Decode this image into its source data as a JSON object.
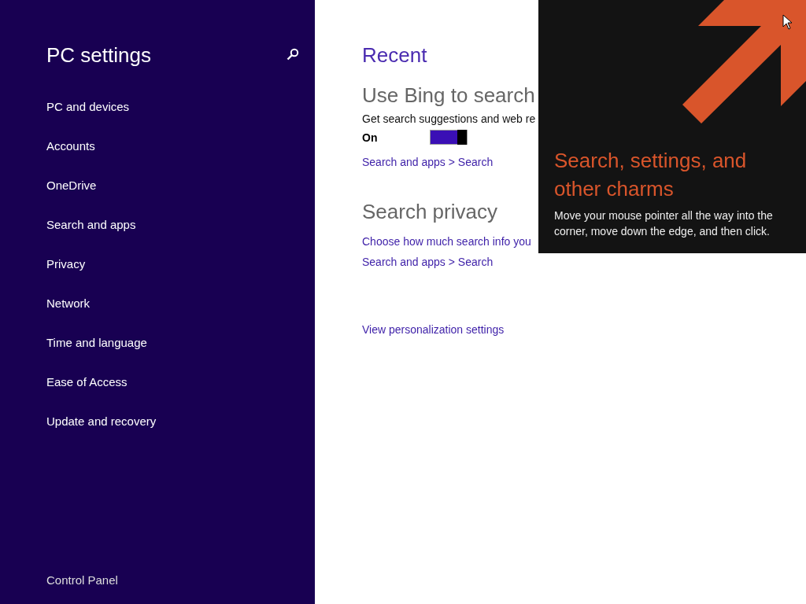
{
  "sidebar": {
    "title": "PC settings",
    "items": [
      {
        "label": "PC and devices"
      },
      {
        "label": "Accounts"
      },
      {
        "label": "OneDrive"
      },
      {
        "label": "Search and apps"
      },
      {
        "label": "Privacy"
      },
      {
        "label": "Network"
      },
      {
        "label": "Time and language"
      },
      {
        "label": "Ease of Access"
      },
      {
        "label": "Update and recovery"
      }
    ],
    "footer_link": "Control Panel"
  },
  "content": {
    "heading": "Recent",
    "sections": [
      {
        "title": "Use Bing to search",
        "description": "Get search suggestions and web re",
        "toggle": {
          "label": "On",
          "on": true
        },
        "path": "Search and apps > Search"
      },
      {
        "title": "Search privacy",
        "link": "Choose how much search info you",
        "path": "Search and apps > Search"
      }
    ],
    "bottom_link": "View personalization settings"
  },
  "tip": {
    "title": "Search, settings, and other charms",
    "body": "Move your mouse pointer all the way into the corner, move down the edge, and then click."
  }
}
